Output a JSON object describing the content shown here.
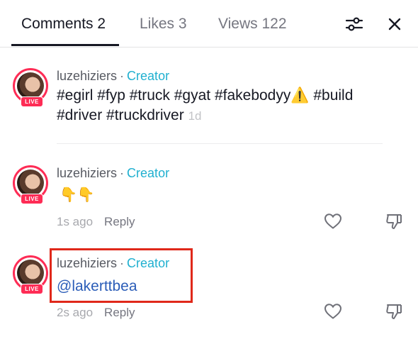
{
  "tabs": [
    {
      "label": "Comments 2",
      "active": true
    },
    {
      "label": "Likes 3",
      "active": false
    },
    {
      "label": "Views 122",
      "active": false
    }
  ],
  "icons": {
    "filter": "sliders-icon",
    "close": "close-icon"
  },
  "post": {
    "author": "luzehiziers",
    "separator": "·",
    "role": "Creator",
    "caption_line1": "#egirl #fyp #truck #gyat #fakebodyy⚠️ #build",
    "caption_line2": "#driver #truckdriver",
    "time": "1d",
    "live_badge": "LIVE"
  },
  "comments": [
    {
      "author": "luzehiziers",
      "separator": "·",
      "role": "Creator",
      "text": "👇👇",
      "time": "1s ago",
      "reply_label": "Reply",
      "live_badge": "LIVE"
    },
    {
      "author": "luzehiziers",
      "separator": "·",
      "role": "Creator",
      "mention": "@lakerttbea",
      "time": "2s ago",
      "reply_label": "Reply",
      "live_badge": "LIVE"
    }
  ],
  "colors": {
    "live": "#fe2c55",
    "creator": "#20b0d0",
    "mention": "#2b5db8",
    "highlight": "#e0281a"
  }
}
